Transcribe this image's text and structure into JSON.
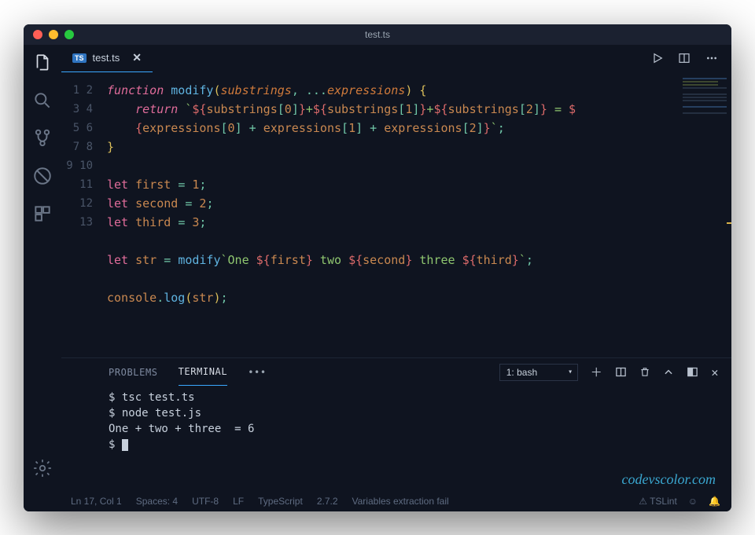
{
  "titlebar": {
    "title": "test.ts"
  },
  "tab": {
    "label": "test.ts",
    "badge": "TS"
  },
  "tab_actions": {},
  "code": {
    "line_count": 13,
    "lines": [
      {
        "n": 1
      },
      {
        "n": 2
      },
      {
        "n": 3
      },
      {
        "n": 4
      },
      {
        "n": 5
      },
      {
        "n": 6
      },
      {
        "n": 7
      },
      {
        "n": 8
      },
      {
        "n": 9
      },
      {
        "n": 10
      },
      {
        "n": 11
      },
      {
        "n": 12
      },
      {
        "n": 13
      }
    ],
    "tokens": {
      "l1": {
        "function": "function",
        "modify": "modify",
        "open": "(",
        "substrings": "substrings",
        "comma": ",",
        "dots": "...",
        "expressions": "expressions",
        "close": ")",
        "brace": "{"
      },
      "l2": {
        "return": "return",
        "tick1": "`",
        "i0o": "${",
        "sub0": "substrings",
        "br0o": "[",
        "z0": "0",
        "br0c": "]",
        "i0c": "}",
        "plus1": "+",
        "i1o": "${",
        "sub1": "substrings",
        "br1o": "[",
        "z1": "1",
        "br1c": "]",
        "i1c": "}",
        "plus2": "+",
        "i2o": "${",
        "sub2": "substrings",
        "br2o": "[",
        "z2": "2",
        "br2c": "]",
        "i2c": "}",
        "eq": " = ",
        "dollar": "$"
      },
      "l2b": {
        "io": "{",
        "exp0": "expressions",
        "b0o": "[",
        "n0": "0",
        "b0c": "]",
        "p1": " + ",
        "exp1": "expressions",
        "b1o": "[",
        "n1": "1",
        "b1c": "]",
        "p2": " + ",
        "exp2": "expressions",
        "b2o": "[",
        "n2": "2",
        "b2c": "]",
        "ic": "}",
        "tick2": "`",
        "semi": ";"
      },
      "l3": {
        "brace_close": "}"
      },
      "l5": {
        "let": "let",
        "name": "first",
        "eq": "=",
        "val": "1",
        "semi": ";"
      },
      "l6": {
        "let": "let",
        "name": "second",
        "eq": "=",
        "val": "2",
        "semi": ";"
      },
      "l7": {
        "let": "let",
        "name": "third",
        "eq": "=",
        "val": "3",
        "semi": ";"
      },
      "l9": {
        "let": "let",
        "name": "str",
        "eq": "=",
        "call": "modify",
        "tick": "`",
        "one": "One ",
        "i1o": "${",
        "first": "first",
        "i1c": "}",
        "two": " two ",
        "i2o": "${",
        "second": "second",
        "i2c": "}",
        "three": " three ",
        "i3o": "${",
        "third": "third",
        "i3c": "}",
        "tick2": "`",
        "semi": ";"
      },
      "l11": {
        "console": "console",
        "dot": ".",
        "log": "log",
        "open": "(",
        "str": "str",
        "close": ")",
        "semi": ";"
      }
    }
  },
  "panel": {
    "tabs": {
      "problems": "PROBLEMS",
      "terminal": "TERMINAL"
    },
    "shell_selected": "1: bash"
  },
  "terminal": {
    "line1": "$ tsc test.ts",
    "line2": "$ node test.js",
    "line3": "One + two + three  = 6",
    "prompt": "$ "
  },
  "watermark": "codevscolor.com",
  "status": {
    "pos": "Ln 17, Col 1",
    "spaces": "Spaces: 4",
    "encoding": "UTF-8",
    "eol": "LF",
    "lang": "TypeScript",
    "ver": "2.7.2",
    "msg": "Variables extraction fail",
    "tslint": "TSLint"
  }
}
